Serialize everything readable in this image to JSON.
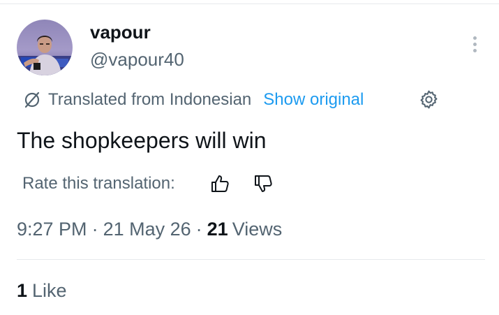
{
  "author": {
    "display_name": "vapour",
    "handle": "@vapour40"
  },
  "translation": {
    "source_label": "Translated from Indonesian",
    "show_original_label": "Show original",
    "translated_text": "The shopkeepers will win",
    "rate_label": "Rate this translation:"
  },
  "meta": {
    "time": "9:27 PM",
    "date": "21 May 26",
    "separator": "·",
    "views_count": "21",
    "views_label": "Views"
  },
  "engagement": {
    "likes_count": "1",
    "likes_label": "Like"
  },
  "icons": {
    "more": "more-vertical-icon",
    "translate": "translate-slash-icon",
    "settings": "gear-icon",
    "thumbs_up": "thumbs-up-icon",
    "thumbs_down": "thumbs-down-icon"
  },
  "colors": {
    "primary_text": "#0f1419",
    "secondary_text": "#536471",
    "link": "#1d9bf0",
    "divider": "#e6e9ec"
  }
}
